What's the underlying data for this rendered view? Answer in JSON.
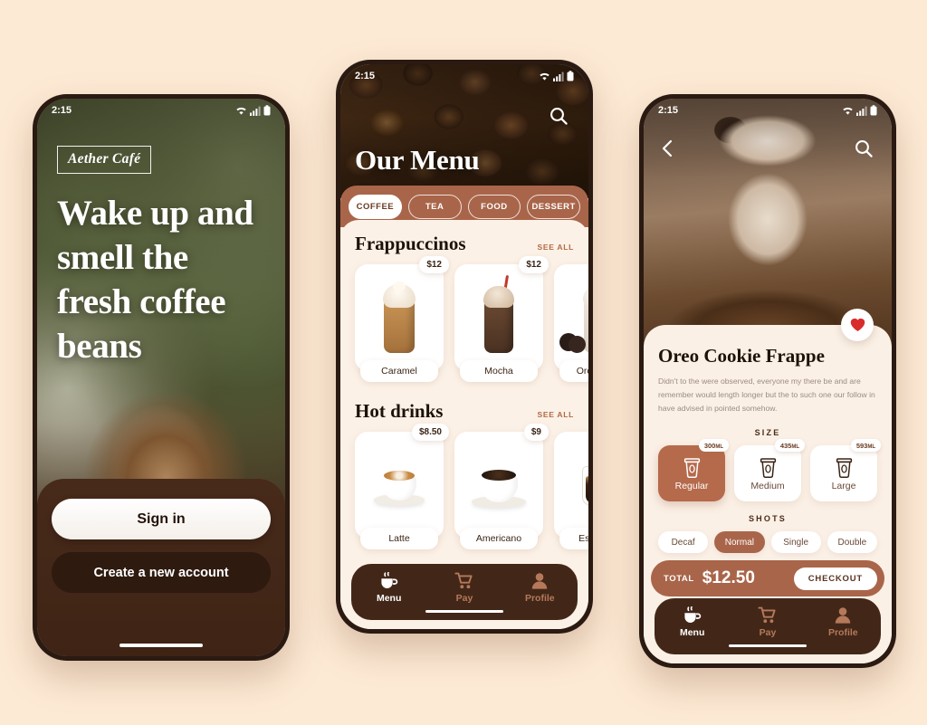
{
  "background_color": "#FDEAD5",
  "accent_brown": "#A9654A",
  "dark_brown": "#422718",
  "status_bar": {
    "time": "2:15",
    "icons": [
      "wifi-icon",
      "signal-icon",
      "battery-icon"
    ]
  },
  "screen_onboarding": {
    "logo": "Aether Café",
    "headline": "Wake up and smell the fresh coffee beans",
    "sign_in_label": "Sign in",
    "create_account_label": "Create a new account"
  },
  "screen_menu": {
    "title": "Our Menu",
    "search_icon": "search-icon",
    "categories": [
      {
        "label": "COFFEE",
        "active": true
      },
      {
        "label": "TEA",
        "active": false
      },
      {
        "label": "FOOD",
        "active": false
      },
      {
        "label": "DESSERT",
        "active": false
      }
    ],
    "sections": [
      {
        "title": "Frappuccinos",
        "see_all": "SEE ALL",
        "items": [
          {
            "name": "Caramel",
            "price": "$12"
          },
          {
            "name": "Mocha",
            "price": "$12"
          },
          {
            "name": "Oreo cook",
            "price": ""
          }
        ]
      },
      {
        "title": "Hot drinks",
        "see_all": "SEE ALL",
        "items": [
          {
            "name": "Latte",
            "price": "$8.50"
          },
          {
            "name": "Americano",
            "price": "$9"
          },
          {
            "name": "Espresso",
            "price": ""
          }
        ]
      }
    ]
  },
  "screen_detail": {
    "back_icon": "chevron-left-icon",
    "search_icon": "search-icon",
    "favorite_icon": "heart-icon",
    "title": "Oreo Cookie Frappe",
    "description": "Didn't to the were observed, everyone my there be and are remember would length longer but the to such one our follow in have advised in pointed somehow.",
    "size_label": "SIZE",
    "sizes": [
      {
        "name": "Regular",
        "volume": "300",
        "unit": "ML",
        "selected": true
      },
      {
        "name": "Medium",
        "volume": "435",
        "unit": "ML",
        "selected": false
      },
      {
        "name": "Large",
        "volume": "593",
        "unit": "ML",
        "selected": false
      }
    ],
    "shots_label": "SHOTS",
    "shots": [
      {
        "label": "Decaf",
        "selected": false
      },
      {
        "label": "Normal",
        "selected": true
      },
      {
        "label": "Single",
        "selected": false
      },
      {
        "label": "Double",
        "selected": false
      }
    ],
    "total_label": "TOTAL",
    "total_value": "$12.50",
    "checkout_label": "CHECKOUT"
  },
  "bottom_nav": [
    {
      "label": "Menu",
      "icon": "coffee-cup-icon",
      "active": true
    },
    {
      "label": "Pay",
      "icon": "shopping-cart-icon",
      "active": false
    },
    {
      "label": "Profile",
      "icon": "person-icon",
      "active": false
    }
  ]
}
